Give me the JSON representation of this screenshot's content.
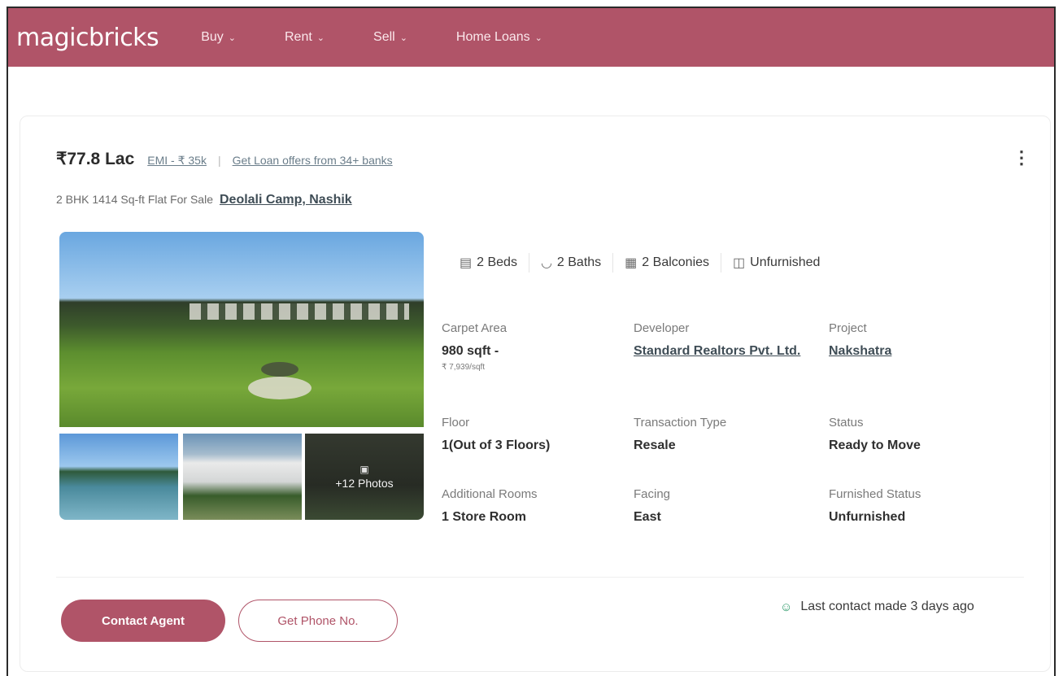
{
  "header": {
    "logo": "magicbricks",
    "nav": [
      {
        "label": "Buy"
      },
      {
        "label": "Rent"
      },
      {
        "label": "Sell"
      },
      {
        "label": "Home Loans"
      }
    ]
  },
  "listing": {
    "price": "₹77.8 Lac",
    "emi": "EMI - ₹ 35k",
    "separator": "|",
    "loan_offers": "Get Loan offers from 34+ banks",
    "title": "2 BHK 1414 Sq-ft Flat For Sale",
    "locality": "Deolali Camp, Nashik",
    "photos_more": "+12 Photos",
    "amenities": [
      {
        "label": "2 Beds",
        "icon": "bed-icon"
      },
      {
        "label": "2 Baths",
        "icon": "bath-icon"
      },
      {
        "label": "2 Balconies",
        "icon": "balcony-icon"
      },
      {
        "label": "Unfurnished",
        "icon": "furniture-icon"
      }
    ],
    "details": {
      "carpet_area": {
        "label": "Carpet Area",
        "value": "980 sqft -",
        "sub": "₹ 7,939/sqft"
      },
      "developer": {
        "label": "Developer",
        "value": "Standard Realtors Pvt. Ltd."
      },
      "project": {
        "label": "Project",
        "value": "Nakshatra"
      },
      "floor": {
        "label": "Floor",
        "value": "1(Out of 3 Floors)"
      },
      "transaction_type": {
        "label": "Transaction Type",
        "value": "Resale"
      },
      "status": {
        "label": "Status",
        "value": "Ready to Move"
      },
      "additional_rooms": {
        "label": "Additional Rooms",
        "value": "1 Store Room"
      },
      "facing": {
        "label": "Facing",
        "value": "East"
      },
      "furnished_status": {
        "label": "Furnished Status",
        "value": "Unfurnished"
      }
    },
    "actions": {
      "contact_agent": "Contact Agent",
      "get_phone": "Get Phone No."
    },
    "last_contact": "Last contact made 3 days ago"
  },
  "colors": {
    "brand": "#b05468",
    "link": "#3f4d56",
    "success": "#2e9a6a"
  }
}
